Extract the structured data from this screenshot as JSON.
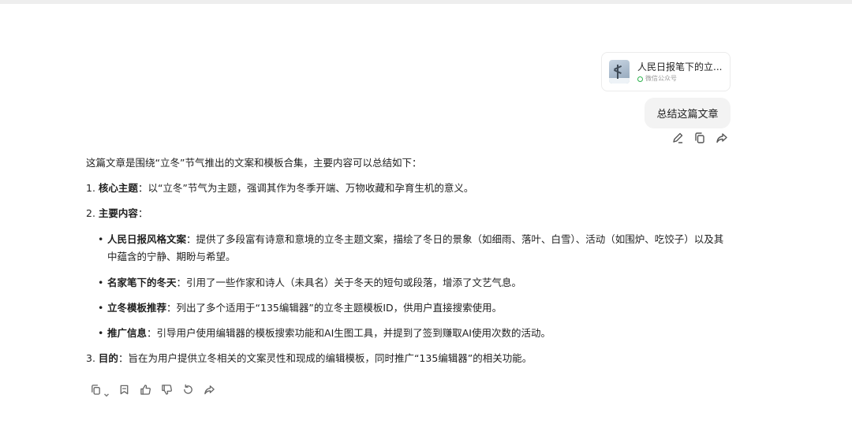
{
  "shared_article": {
    "title": "人民日报笔下的立...",
    "source": "微信公众号"
  },
  "user_message": "总结这篇文章",
  "answer": {
    "intro": "这篇文章是围绕“立冬”节气推出的文案和模板合集，主要内容可以总结如下：",
    "item1_num": "1.",
    "item1_label": "核心主题",
    "item1_text": "：以“立冬”节气为主题，强调其作为冬季开端、万物收藏和孕育生机的意义。",
    "item2_num": "2.",
    "item2_label": "主要内容",
    "item2_text": "：",
    "sub_items": [
      {
        "label": "人民日报风格文案",
        "text": "：提供了多段富有诗意和意境的立冬主题文案，描绘了冬日的景象（如细雨、落叶、白雪）、活动（如围炉、吃饺子）以及其中蕴含的宁静、期盼与希望。"
      },
      {
        "label": "名家笔下的冬天",
        "text": "：引用了一些作家和诗人（未具名）关于冬天的短句或段落，增添了文艺气息。"
      },
      {
        "label": "立冬模板推荐",
        "text": "：列出了多个适用于“135编辑器”的立冬主题模板ID，供用户直接搜索使用。"
      },
      {
        "label": "推广信息",
        "text": "：引导用户使用编辑器的模板搜索功能和AI生图工具，并提到了签到赚取AI使用次数的活动。"
      }
    ],
    "item3_num": "3.",
    "item3_label": "目的",
    "item3_text": "：旨在为用户提供立冬相关的文案灵性和现成的编辑模板，同时推广“135编辑器”的相关功能。"
  },
  "icons": {
    "message_actions": [
      "edit-icon",
      "copy-icon",
      "share-icon"
    ],
    "answer_actions": [
      "copy-icon",
      "chevron-down-icon",
      "bookmark-icon",
      "thumbs-up-icon",
      "thumbs-down-icon",
      "regenerate-icon",
      "share-icon"
    ]
  },
  "colors": {
    "bubble_bg": "#f3f3f3",
    "wechat_green": "#2bb24c"
  }
}
